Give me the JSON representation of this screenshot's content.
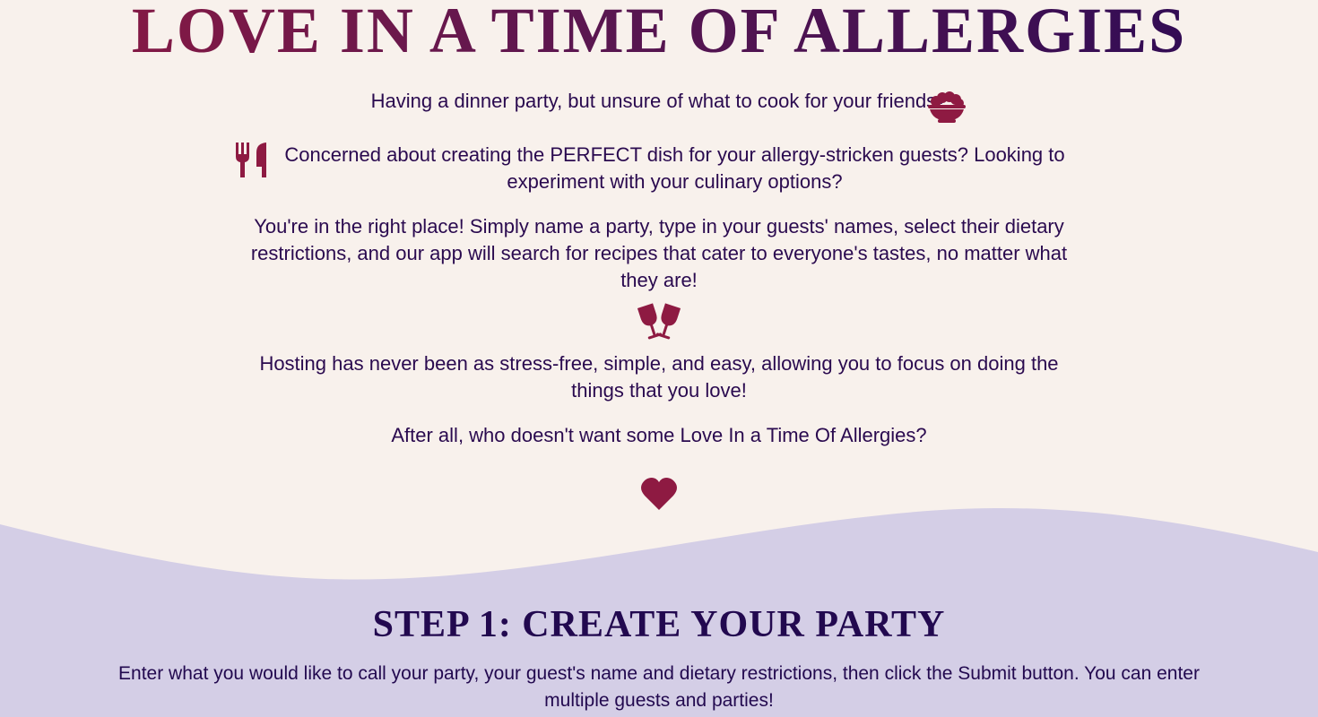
{
  "hero": {
    "title": "LOVE IN A TIME OF ALLERGIES",
    "paragraphs": [
      "Having a dinner party, but unsure of what to cook for your friends?",
      "Concerned about creating the PERFECT dish for your allergy-stricken guests? Looking to experiment with your culinary options?",
      "You're in the right place! Simply name a party, type in your guests' names, select their dietary restrictions, and our app will search for recipes that cater to everyone's tastes, no matter what they are!",
      "Hosting has never been as stress-free, simple, and easy, allowing you to focus on doing the things that you love!",
      "After all, who doesn't want some Love In a Time Of Allergies?"
    ]
  },
  "icons": {
    "bowl": "bowl-food-icon",
    "utensils": "utensils-icon",
    "glasses": "wine-glasses-cheers-icon",
    "heart": "heart-icon"
  },
  "step1": {
    "title": "STEP 1: CREATE YOUR PARTY",
    "description": "Enter what you would like to call your party, your guest's name and dietary restrictions, then click the Submit button. You can enter multiple guests and parties!"
  },
  "colors": {
    "background": "#f8f1ec",
    "wave": "#d4cee6",
    "accent": "#8e1a42",
    "text": "#2a0a4f"
  }
}
